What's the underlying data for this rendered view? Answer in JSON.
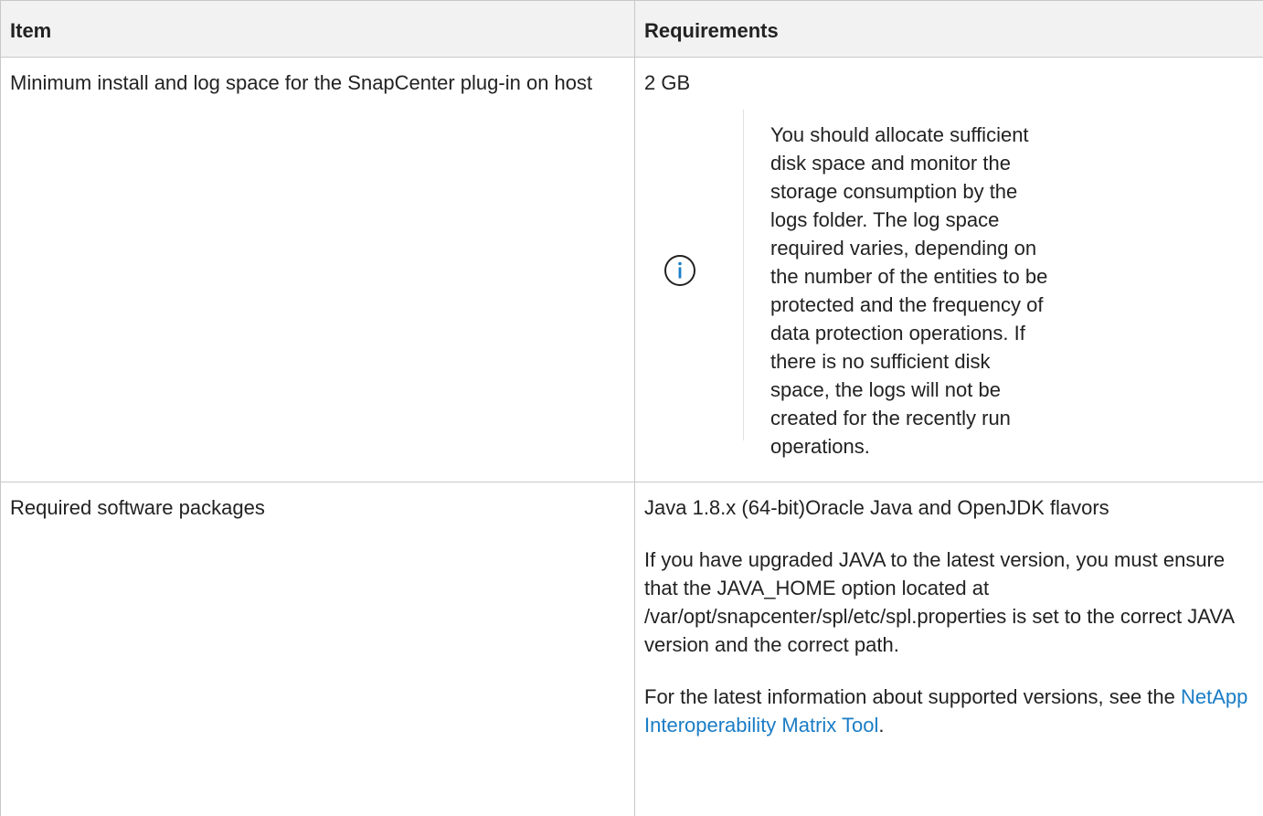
{
  "table": {
    "headers": {
      "item": "Item",
      "requirements": "Requirements"
    },
    "rows": [
      {
        "item": "Minimum install and log space for the SnapCenter plug-in on host",
        "requirement": "2 GB",
        "note": {
          "icon": "info-icon",
          "text": "You should allocate sufficient disk space and monitor the storage consumption by the logs folder. The log space required varies, depending on the number of the entities to be protected and the frequency of data protection operations. If there is no sufficient disk space, the logs will not be created for the recently run operations."
        }
      },
      {
        "item": "Required software packages",
        "requirement": "Java 1.8.x (64-bit)Oracle Java and OpenJDK flavors",
        "paragraph_2": "If you have upgraded JAVA to the latest version, you must ensure that the JAVA_HOME option located at /var/opt/snapcenter/spl/etc/spl.properties is set to the correct JAVA version and the correct path.",
        "paragraph_3_prefix": "For the latest information about supported versions, see the ",
        "link_text": "NetApp Interoperability Matrix Tool",
        "paragraph_3_suffix": "."
      }
    ]
  },
  "colors": {
    "link": "#1a7dc6",
    "header_bg": "#f2f2f2",
    "border": "#c8c8c8",
    "icon": "#1a7dc6"
  }
}
